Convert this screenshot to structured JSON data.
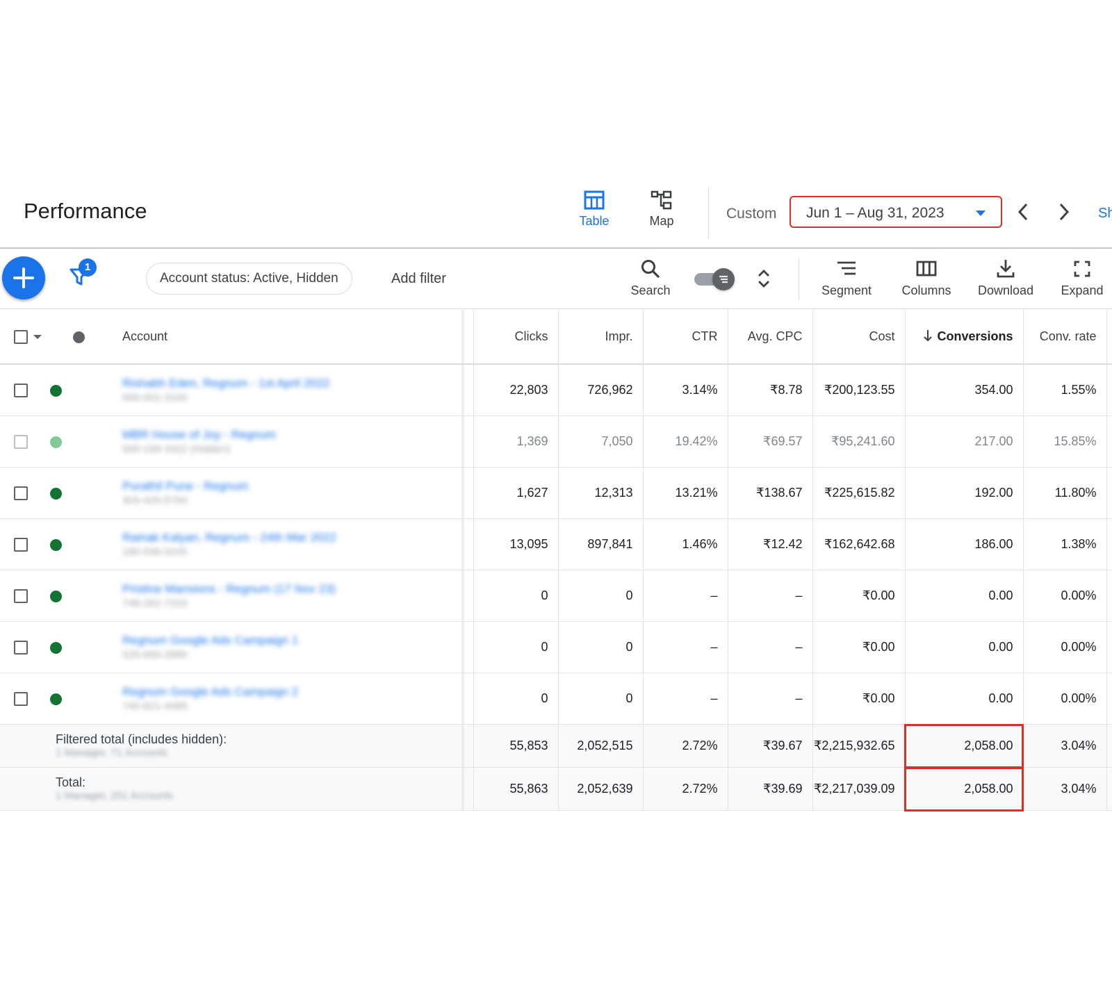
{
  "header": {
    "title": "Performance",
    "view_tabs": [
      {
        "label": "Table",
        "icon": "table-icon",
        "active": true
      },
      {
        "label": "Map",
        "icon": "map-icon",
        "active": false
      }
    ],
    "date_range_label": "Custom",
    "date_range": "Jun 1 – Aug 31, 2023",
    "share_label": "Sh"
  },
  "toolbar": {
    "filter_count": "1",
    "filter_chip": "Account status: Active, Hidden",
    "add_filter": "Add filter",
    "tools": {
      "search": "Search",
      "segment": "Segment",
      "columns": "Columns",
      "download": "Download",
      "expand": "Expand"
    }
  },
  "table": {
    "columns": {
      "account": "Account",
      "clicks": "Clicks",
      "impr": "Impr.",
      "ctr": "CTR",
      "avg_cpc": "Avg. CPC",
      "cost": "Cost",
      "conversions": "Conversions",
      "conv_rate": "Conv. rate"
    },
    "rows": [
      {
        "account": "Rishabh Eden, Regnum - 1st April 2022",
        "id": "909-001-3100",
        "status": "active",
        "clicks": "22,803",
        "impr": "726,962",
        "ctr": "3.14%",
        "avg_cpc": "₹8.78",
        "cost": "₹200,123.55",
        "conversions": "354.00",
        "conv_rate": "1.55%"
      },
      {
        "account": "MBR House of Joy - Regnum",
        "id": "500-199-3322 (Hidden)",
        "status": "hidden",
        "clicks": "1,369",
        "impr": "7,050",
        "ctr": "19.42%",
        "avg_cpc": "₹69.57",
        "cost": "₹95,241.60",
        "conversions": "217.00",
        "conv_rate": "15.85%"
      },
      {
        "account": "Purathil Pune - Regnum",
        "id": "303-425-5794",
        "status": "active",
        "clicks": "1,627",
        "impr": "12,313",
        "ctr": "13.21%",
        "avg_cpc": "₹138.67",
        "cost": "₹225,615.82",
        "conversions": "192.00",
        "conv_rate": "11.80%"
      },
      {
        "account": "Rainak Kalyan, Regnum - 24th Mar 2022",
        "id": "180-936-5245",
        "status": "active",
        "clicks": "13,095",
        "impr": "897,841",
        "ctr": "1.46%",
        "avg_cpc": "₹12.42",
        "cost": "₹162,642.68",
        "conversions": "186.00",
        "conv_rate": "1.38%"
      },
      {
        "account": "Pristine Mansions - Regnum (17 Nov 23)",
        "id": "748-262-7319",
        "status": "active",
        "clicks": "0",
        "impr": "0",
        "ctr": "–",
        "avg_cpc": "–",
        "cost": "₹0.00",
        "conversions": "0.00",
        "conv_rate": "0.00%"
      },
      {
        "account": "Regnum Google Ads Campaign 1",
        "id": "529-669-2880",
        "status": "active",
        "clicks": "0",
        "impr": "0",
        "ctr": "–",
        "avg_cpc": "–",
        "cost": "₹0.00",
        "conversions": "0.00",
        "conv_rate": "0.00%"
      },
      {
        "account": "Regnum Google Ads Campaign 2",
        "id": "745-821-4089",
        "status": "active",
        "clicks": "0",
        "impr": "0",
        "ctr": "–",
        "avg_cpc": "–",
        "cost": "₹0.00",
        "conversions": "0.00",
        "conv_rate": "0.00%"
      }
    ],
    "totals": [
      {
        "label": "Filtered total (includes hidden):",
        "sub": "1 Manager, 71 Accounts",
        "clicks": "55,853",
        "impr": "2,052,515",
        "ctr": "2.72%",
        "avg_cpc": "₹39.67",
        "cost": "₹2,215,932.65",
        "conversions": "2,058.00",
        "conv_rate": "3.04%"
      },
      {
        "label": "Total:",
        "sub": "1 Manager, 251 Accounts",
        "clicks": "55,863",
        "impr": "2,052,639",
        "ctr": "2.72%",
        "avg_cpc": "₹39.69",
        "cost": "₹2,217,039.09",
        "conversions": "2,058.00",
        "conv_rate": "3.04%"
      }
    ]
  },
  "colors": {
    "accent": "#1a73e8",
    "highlight": "#d93025",
    "status_active": "#137333",
    "status_hidden": "#81c995"
  }
}
